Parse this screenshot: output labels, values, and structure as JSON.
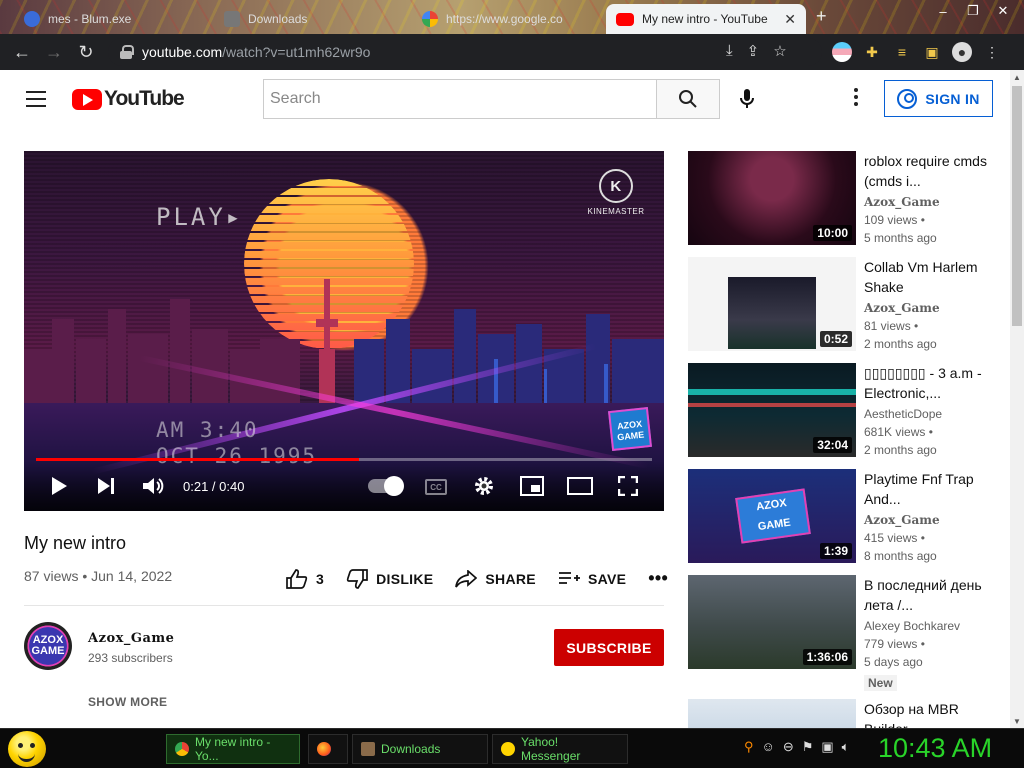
{
  "browser": {
    "tabs": [
      {
        "label": "mes - Blum.exe",
        "active": false
      },
      {
        "label": "Downloads",
        "active": false
      },
      {
        "label": "https://www.google.co",
        "active": false
      },
      {
        "label": "My new intro - YouTube",
        "active": true
      }
    ],
    "url_host": "youtube.com",
    "url_path": "/watch?v=ut1mh62wr9o"
  },
  "yt": {
    "logo_text": "YouTube",
    "search_placeholder": "Search",
    "signin_label": "SIGN IN"
  },
  "player": {
    "overlay_play": "PLAY▸",
    "overlay_time": "AM  3:40",
    "overlay_date": "OCT 26 1995",
    "watermark": "KINEMASTER",
    "channel_watermark": "AZOX GAME",
    "current_time": "0:21",
    "duration": "0:40",
    "time_display": "0:21 / 0:40",
    "progress_fraction": 0.525
  },
  "video": {
    "title": "My new intro",
    "meta": "87 views • Jun 14, 2022",
    "likes": "3",
    "dislike_label": "DISLIKE",
    "share_label": "SHARE",
    "save_label": "SAVE"
  },
  "channel": {
    "name": "Azox_Game",
    "subscribers": "293 subscribers",
    "avatar_text": "AZOX GAME",
    "subscribe_label": "SUBSCRIBE",
    "show_more_label": "SHOW MORE"
  },
  "recommendations": [
    {
      "title": "roblox require cmds (cmds i...",
      "channel": "Azox_Game",
      "views": "109 views •",
      "age": "5 months ago",
      "duration": "10:00"
    },
    {
      "title": "Collab Vm Harlem Shake",
      "channel": "Azox_Game",
      "views": "81 views •",
      "age": "2 months ago",
      "duration": "0:52"
    },
    {
      "title": "▯▯▯▯▯▯▯▯ - 3 a.m - Electronic,...",
      "channel": "AestheticDope",
      "views": "681K views •",
      "age": "2 months ago",
      "duration": "32:04"
    },
    {
      "title": "Playtime Fnf Trap And...",
      "channel": "Azox_Game",
      "views": "415 views •",
      "age": "8 months ago",
      "duration": "1:39"
    },
    {
      "title": "В последний день лета /...",
      "channel": "Alexey Bochkarev",
      "views": "779 views •",
      "age": "5 days ago",
      "duration": "1:36:06",
      "badge": "New"
    },
    {
      "title": "Обзор на MBR Builder",
      "channel": "",
      "views": "",
      "age": "",
      "duration": ""
    }
  ],
  "taskbar": {
    "tasks": [
      {
        "label": "My new intro - Yo...",
        "active": true
      },
      {
        "label": "",
        "active": false
      },
      {
        "label": "Downloads",
        "active": false
      },
      {
        "label": "Yahoo! Messenger",
        "active": false
      }
    ],
    "clock": "10:43 AM"
  },
  "colors": {
    "yt_red": "#ff0000",
    "subscribe_red": "#cc0000",
    "signin_blue": "#065fd4",
    "clock_green": "#29d429"
  }
}
